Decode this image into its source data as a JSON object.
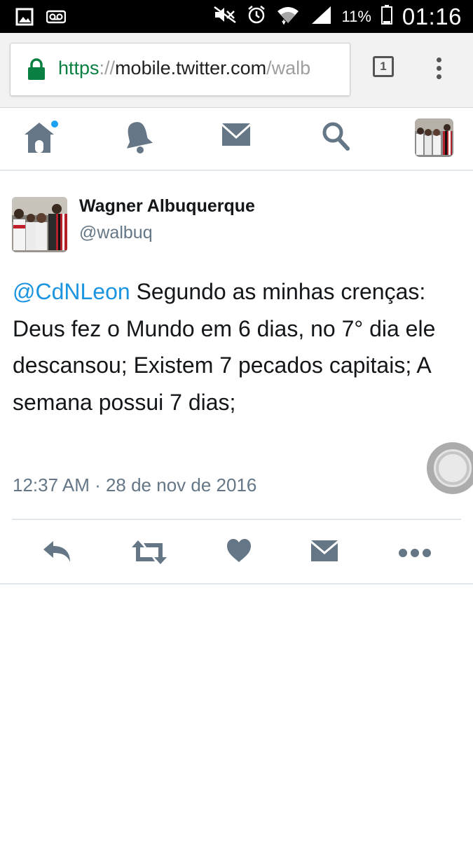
{
  "status_bar": {
    "battery_percent": "11%",
    "time": "01:16"
  },
  "browser": {
    "url_scheme": "https",
    "url_separator": "://",
    "url_host": "mobile.twitter.com",
    "url_path": "/walb",
    "tab_count": "1"
  },
  "nav": {
    "items": [
      "home-icon",
      "notifications-icon",
      "messages-icon",
      "search-icon",
      "profile-avatar"
    ],
    "home_has_notification": true,
    "accent_color": "#1da1f2",
    "icon_color": "#657786"
  },
  "tweet": {
    "author_name": "Wagner Albuquerque",
    "author_handle": "@walbuq",
    "mention": "@CdNLeon",
    "body": " Segundo as minhas crenças: Deus fez o Mundo em 6 dias, no 7° dia ele descansou; Existem 7 pecados capitais; A semana possui 7 dias;",
    "timestamp": "12:37 AM · 28 de nov de 2016",
    "mention_color": "#1b95e0"
  },
  "actions": [
    "reply-icon",
    "retweet-icon",
    "like-icon",
    "direct-message-icon",
    "more-icon"
  ]
}
